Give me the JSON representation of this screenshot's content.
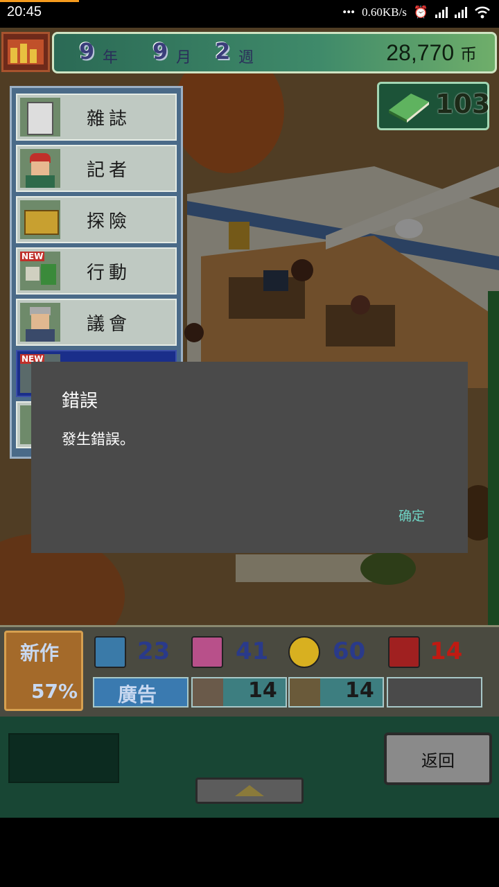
{
  "status_bar": {
    "time": "20:45",
    "net_speed": "0.60KB/s",
    "icons": [
      "more-dots-icon",
      "alarm-icon",
      "hd-signal-icon",
      "signal-icon",
      "wifi-icon"
    ]
  },
  "header": {
    "year_num": "9",
    "year_unit": "年",
    "month_num": "9",
    "month_unit": "月",
    "week_num": "2",
    "week_unit": "週",
    "money": "28,770",
    "money_unit": "币",
    "books": "103"
  },
  "menu": {
    "items": [
      {
        "label": "雜誌",
        "icon": "magazine-icon"
      },
      {
        "label": "記者",
        "icon": "reporter-icon"
      },
      {
        "label": "探險",
        "icon": "treasure-chest-icon"
      },
      {
        "label": "行動",
        "icon": "new-action-icon",
        "badge": "NEW"
      },
      {
        "label": "議會",
        "icon": "councilor-icon"
      },
      {
        "label": "",
        "icon": "new-item-icon",
        "badge": "NEW"
      },
      {
        "label": "",
        "icon": "settings-icon"
      }
    ]
  },
  "dialog": {
    "title": "錯誤",
    "message": "發生錯誤。",
    "ok_label": "确定"
  },
  "stats": {
    "new_label": "新作",
    "new_percent": "57%",
    "values": [
      "23",
      "41",
      "60",
      "14"
    ],
    "ad_label": "廣告",
    "ad_values": [
      "14",
      "14"
    ],
    "colors": {
      "value": "#2a3a8a",
      "value_red": "#c01a12",
      "panel": "#4a4a40"
    }
  },
  "nav": {
    "back_label": "返回"
  }
}
